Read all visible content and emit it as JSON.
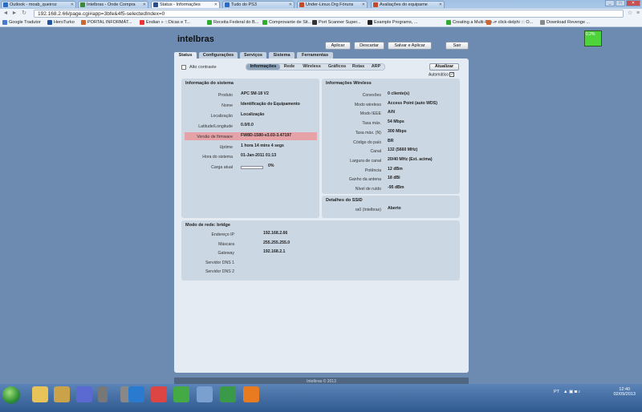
{
  "browser": {
    "tabs": [
      {
        "title": "Outlook - moab_queiroz",
        "active": false,
        "color": "#2a6bc4"
      },
      {
        "title": "Intelbras - Onde Compra",
        "active": false,
        "color": "#3a8a3a"
      },
      {
        "title": "Status - Informações",
        "active": true,
        "color": "#2a4d8a"
      },
      {
        "title": "Tudo do PS3",
        "active": false,
        "color": "#2a6bc4"
      },
      {
        "title": "Under-Linux.Org Fóruns",
        "active": false,
        "color": "#c24a2a"
      },
      {
        "title": "Avaliações do equipame",
        "active": false,
        "color": "#c24a2a"
      }
    ],
    "url": "192.168.2.66/page.cgi#app=3bfe&4f5-selectedIndex=0",
    "bookmarks": [
      {
        "label": "Google Tradutor",
        "color": "#4a7ad0"
      },
      {
        "label": "HeroTurko",
        "color": "#2255a0"
      },
      {
        "label": "PORTAL INFORMÁT...",
        "color": "#c63"
      },
      {
        "label": "Endian » :::Dicas e T...",
        "color": "#e33"
      },
      {
        "label": "Receita Federal do B...",
        "color": "#3a3"
      },
      {
        "label": "Comprovante de Sit...",
        "color": "#3a3"
      },
      {
        "label": "Port Scanner Super...",
        "color": "#333"
      },
      {
        "label": "Example Programs, ...",
        "color": "#222"
      },
      {
        "label": "Creating a Multi-File...",
        "color": "#3a3"
      },
      {
        "label": "-= click-delphi ::: O...",
        "color": "#c63"
      },
      {
        "label": "Download Revenge ...",
        "color": "#888"
      }
    ]
  },
  "app": {
    "logo": "intelbras",
    "buttons": {
      "apply": "Aplicar",
      "discard": "Descartar",
      "save_apply": "Salvar e Aplicar",
      "logout": "Sair"
    },
    "signal_value": "0.2%",
    "main_tabs": [
      "Status",
      "Configurações",
      "Serviços",
      "Sistema",
      "Ferramentas"
    ],
    "high_contrast": "Alto contraste",
    "sub_tabs": [
      "Informações",
      "Rede",
      "Wireless",
      "Gráficos",
      "Rotas",
      "ARP"
    ],
    "refresh": "Atualizar",
    "automatic": "Automático",
    "system": {
      "title": "Informação do sistema",
      "rows": [
        {
          "label": "Produto",
          "value": "APC 5M-18 V2"
        },
        {
          "label": "Nome",
          "value": "Identificação do Equipamento"
        },
        {
          "label": "Localização",
          "value": "Localização"
        },
        {
          "label": "Latitude/Longitude",
          "value": "0.0/0.0"
        },
        {
          "label": "Versão de firmware",
          "value": "FW8D-1580-v3.03-3.47197"
        },
        {
          "label": "Uptime",
          "value": "1 hora 14 mins 4 segs"
        },
        {
          "label": "Hora do sistema",
          "value": "01-Jan-2011 01:13"
        },
        {
          "label": "Carga atual",
          "value": "0%"
        }
      ],
      "load_fraction": 0
    },
    "wireless": {
      "title": "Informações Wireless",
      "rows": [
        {
          "label": "Conexões",
          "value": "0 cliente(s)"
        },
        {
          "label": "Modo wireless",
          "value": "Access Point (auto WDS)"
        },
        {
          "label": "Modo IEEE",
          "value": "A/N"
        },
        {
          "label": "Taxa máx.",
          "value": "54 Mbps"
        },
        {
          "label": "Taxa máx. (N)",
          "value": "300 Mbps"
        },
        {
          "label": "Código do país",
          "value": "BR"
        },
        {
          "label": "Canal",
          "value": "132 (5660 MHz)"
        },
        {
          "label": "Largura de canal",
          "value": "20/40 MHz (Ext. acima)"
        },
        {
          "label": "Potência",
          "value": "12 dBm"
        },
        {
          "label": "Ganho da antena",
          "value": "18 dBi"
        },
        {
          "label": "Nível de ruído",
          "value": "-95 dBm"
        }
      ]
    },
    "ssid": {
      "title": "Detalhes do SSID",
      "rows": [
        {
          "label": "ra0 (Intelbras)",
          "value": "Aberto"
        }
      ]
    },
    "network": {
      "title": "Modo de rede: bridge",
      "rows": [
        {
          "label": "Endereço IP",
          "value": "192.168.2.66"
        },
        {
          "label": "Máscara",
          "value": "255.255.255.0"
        },
        {
          "label": "Gateway",
          "value": "192.168.2.1"
        },
        {
          "label": "Servidor DNS 1",
          "value": ""
        },
        {
          "label": "Servidor DNS 2",
          "value": ""
        }
      ]
    },
    "footer": "Intelbras © 2013"
  },
  "taskbar": {
    "lang": "PT",
    "time": "12:40",
    "date": "02/09/2013",
    "apps": [
      {
        "name": "explorer",
        "color": "#e8c35a"
      },
      {
        "name": "folder2",
        "color": "#c9a24a"
      },
      {
        "name": "media",
        "color": "#5a6ad0"
      },
      {
        "name": "network",
        "color": "#777"
      },
      {
        "name": "network2",
        "color": "#888"
      },
      {
        "name": "ie",
        "color": "#2a7ad0"
      },
      {
        "name": "chrome",
        "color": "#d44"
      },
      {
        "name": "tool",
        "color": "#4a4"
      },
      {
        "name": "box",
        "color": "#7aa0d0"
      },
      {
        "name": "net",
        "color": "#3a9a4a"
      },
      {
        "name": "app",
        "color": "#e87a20"
      }
    ]
  }
}
